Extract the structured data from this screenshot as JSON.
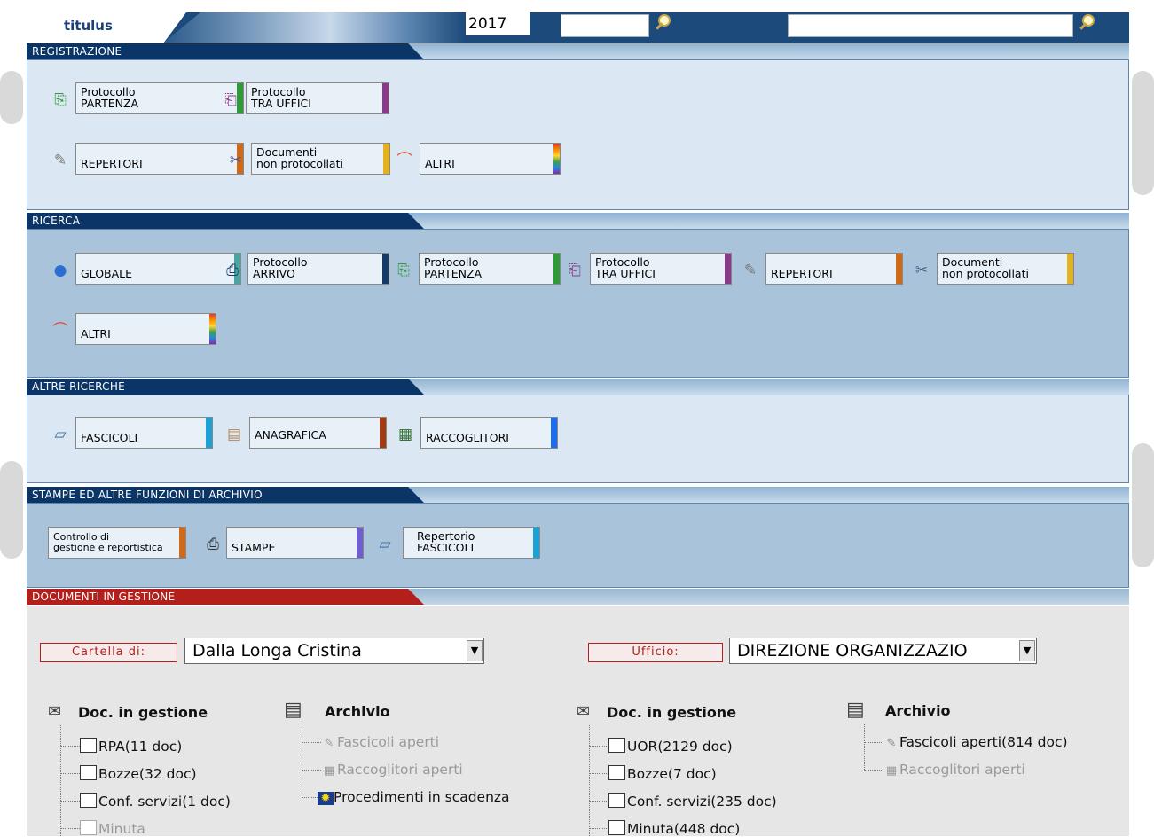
{
  "header": {
    "logo": "titulus",
    "year": "2017",
    "search1_value": "",
    "search2_value": ""
  },
  "sections": {
    "registrazione": "REGISTRAZIONE",
    "ricerca": "RICERCA",
    "altre_ricerche": "ALTRE RICERCHE",
    "stampe": "STAMPE ED ALTRE FUNZIONI DI ARCHIVIO",
    "documenti": "DOCUMENTI IN GESTIONE"
  },
  "registrazione": {
    "partenza": [
      "Protocollo",
      "PARTENZA"
    ],
    "tra_uffici": [
      "Protocollo",
      "TRA UFFICI"
    ],
    "repertori": "REPERTORI",
    "non_protocollati": [
      "Documenti",
      "non protocollati"
    ],
    "altri": "ALTRI"
  },
  "ricerca": {
    "globale": "GLOBALE",
    "arrivo": [
      "Protocollo",
      "ARRIVO"
    ],
    "partenza": [
      "Protocollo",
      "PARTENZA"
    ],
    "tra_uffici": [
      "Protocollo",
      "TRA UFFICI"
    ],
    "repertori": "REPERTORI",
    "non_protocollati": [
      "Documenti",
      "non protocollati"
    ],
    "altri": "ALTRI"
  },
  "altre_ricerche": {
    "fascicoli": "FASCICOLI",
    "anagrafica": "ANAGRAFICA",
    "raccoglitori": "RACCOGLITORI"
  },
  "stampe": {
    "controllo": [
      "Controllo di",
      "gestione e reportistica"
    ],
    "stampe": "STAMPE",
    "repertorio": [
      "Repertorio",
      "FASCICOLI"
    ]
  },
  "gestione": {
    "cartella_label": "Cartella di:",
    "cartella_value": "Dalla Longa Cristina",
    "ufficio_label": "Ufficio:",
    "ufficio_value": "DIREZIONE ORGANIZZAZIO",
    "left_doc": {
      "title": "Doc. in gestione",
      "items": [
        "RPA(11 doc)",
        "Bozze(32 doc)",
        "Conf. servizi(1 doc)",
        "Minuta"
      ]
    },
    "left_archivio": {
      "title": "Archivio",
      "items": [
        "Fascicoli aperti",
        "Raccoglitori aperti",
        "Procedimenti in scadenza"
      ]
    },
    "right_doc": {
      "title": "Doc. in gestione",
      "items": [
        "UOR(2129 doc)",
        "Bozze(7 doc)",
        "Conf. servizi(235 doc)",
        "Minuta(448 doc)"
      ]
    },
    "right_archivio": {
      "title": "Archivio",
      "items": [
        "Fascicoli aperti(814 doc)",
        "Raccoglitori aperti"
      ]
    }
  },
  "colors": {
    "header_blue": "#1c4a7a",
    "section_tab": "#0a3566",
    "docs_tab": "#b3201c",
    "partenza": "#2e9a3a",
    "tra_uffici": "#8b3a8b",
    "repertori": "#d06a18",
    "non_protocollati": "#e3b220",
    "globale": "#4aa5a0",
    "arrivo": "#143a6b",
    "fascicoli": "#1ba0d8",
    "anagrafica": "#a33a12",
    "raccoglitori": "#1c6cf0",
    "stampe": "#6e5ed2"
  }
}
